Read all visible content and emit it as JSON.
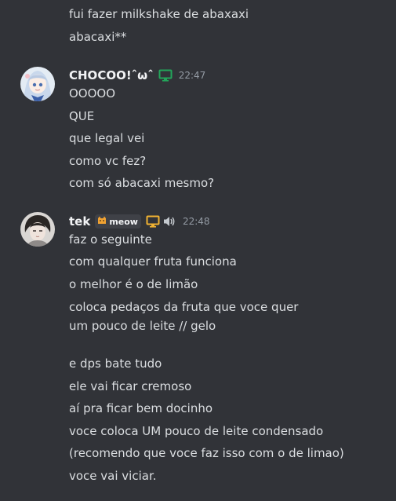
{
  "prev_message": {
    "lines": [
      "fui fazer milkshake de abaxaxi",
      "abacaxi**"
    ]
  },
  "msg1": {
    "username": "CHOCOO!ˆωˆ",
    "icon": "monitor-icon",
    "icon_color": "#23a55a",
    "timestamp": "22:47",
    "lines": [
      "OOOOO",
      "QUE",
      "que legal vei",
      "como vc fez?",
      "com só abacaxi mesmo?"
    ]
  },
  "msg2": {
    "username": "tek",
    "clan_tag": "meow",
    "clan_emoji": "cat-icon",
    "icons": [
      "monitor-icon",
      "speaker-icon"
    ],
    "icon_color": "#f0b232",
    "timestamp": "22:48",
    "lines": [
      "faz o seguinte",
      "com qualquer fruta funciona",
      "o melhor é o de limão",
      "coloca pedaços da fruta que voce quer",
      "um pouco de leite // gelo",
      "e dps bate tudo",
      "ele vai ficar cremoso",
      "aí pra ficar bem docinho",
      "voce coloca UM pouco de leite condensado",
      "(recomendo que voce faz isso com o de limao)",
      "voce vai viciar."
    ]
  },
  "colors": {
    "background": "#313338",
    "text": "#dbdee1",
    "username": "#f2f3f5",
    "timestamp": "#949ba4"
  }
}
